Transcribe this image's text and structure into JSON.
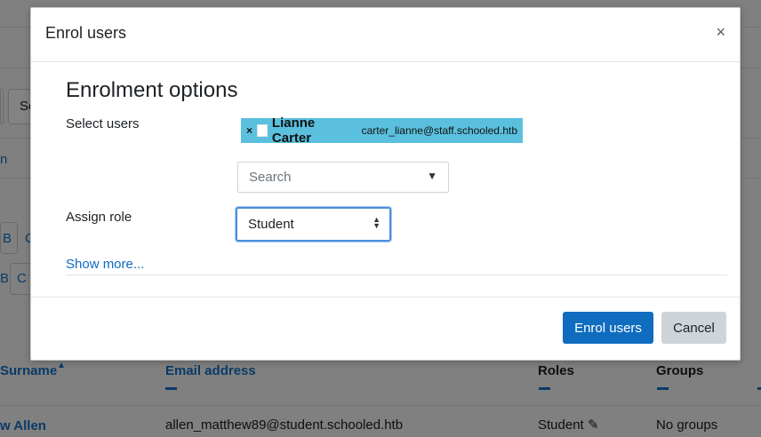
{
  "background": {
    "search_fragment": "Se",
    "alpha_row1": [
      "B",
      "C"
    ],
    "alpha_row2": [
      "B",
      "C"
    ],
    "link_stub": "n",
    "columns": {
      "surname": "Surname",
      "email": "Email address",
      "roles": "Roles",
      "groups": "Groups"
    },
    "row": {
      "name_fragment": "w Allen",
      "email": "allen_matthew89@student.schooled.htb",
      "role": "Student",
      "groups": "No groups"
    }
  },
  "modal": {
    "title": "Enrol users",
    "close_symbol": "×",
    "section_heading": "Enrolment options",
    "select_users_label": "Select users",
    "selected_user": {
      "remove_symbol": "×",
      "name": "Lianne Carter",
      "email": "carter_lianne@staff.schooled.htb"
    },
    "search": {
      "placeholder": "Search",
      "caret": "▼"
    },
    "assign_role_label": "Assign role",
    "role_select": {
      "value": "Student"
    },
    "show_more": "Show more...",
    "enrol_button": "Enrol users",
    "cancel_button": "Cancel"
  },
  "colors": {
    "primary": "#0f6cbf",
    "chip": "#5bc0de",
    "secondary_button": "#ced4da",
    "focus_border": "#4a90d9"
  }
}
